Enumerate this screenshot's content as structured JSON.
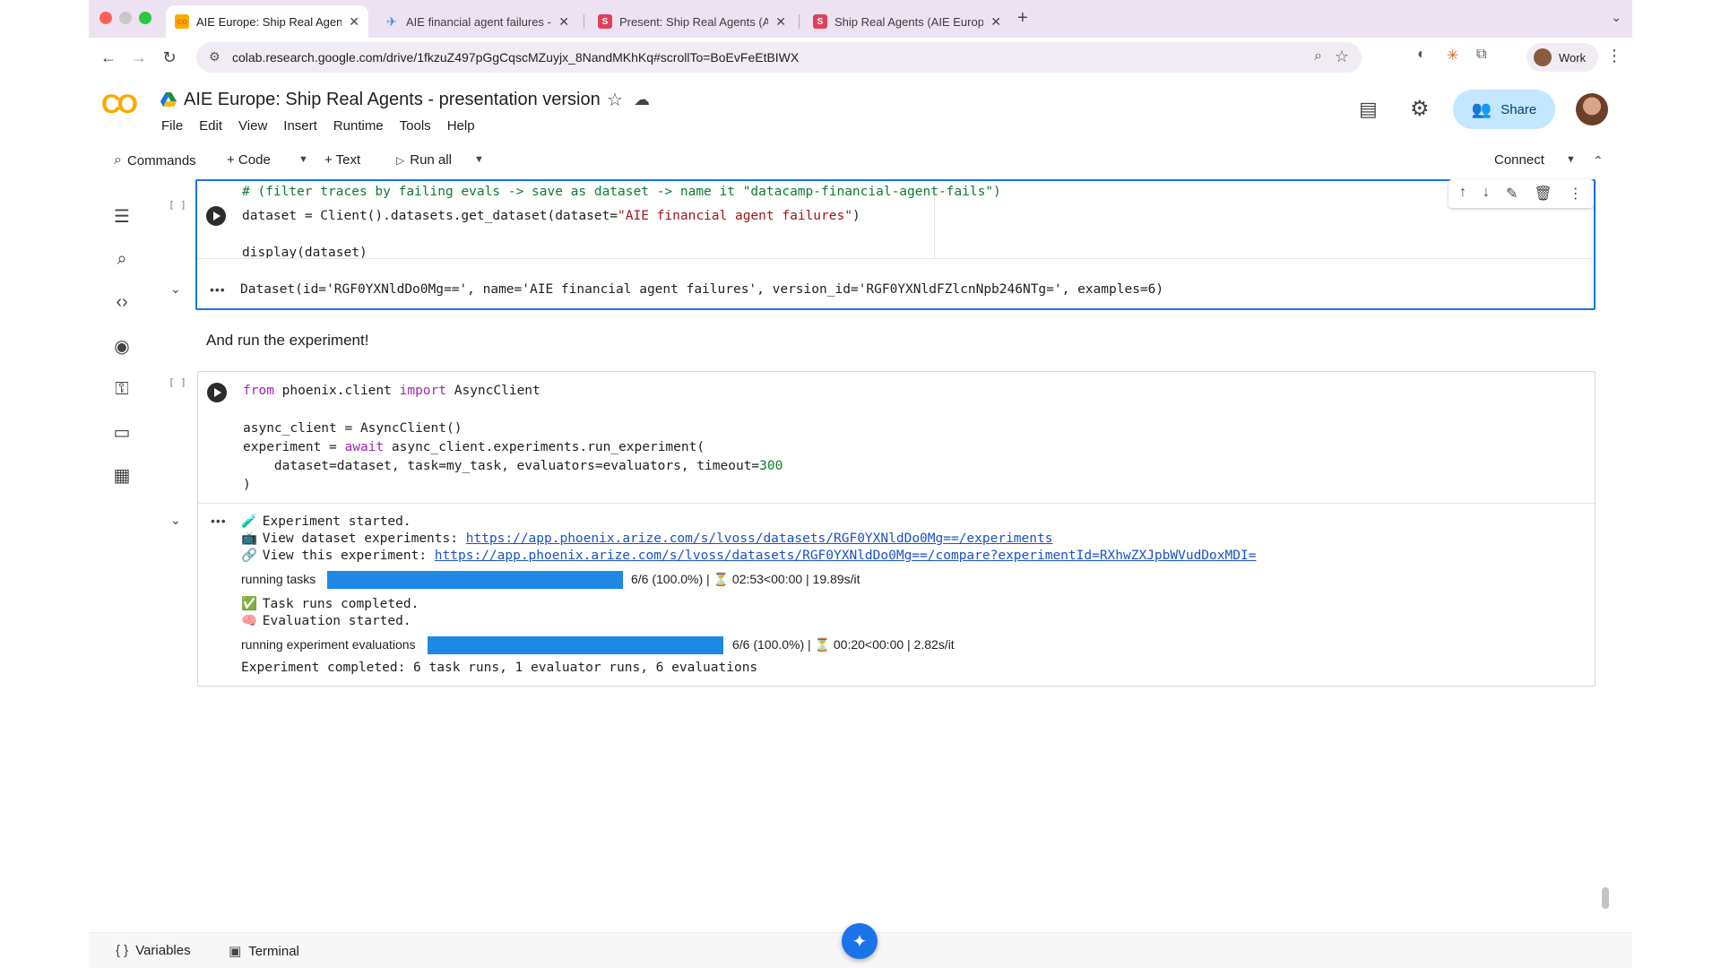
{
  "browser": {
    "tabs": [
      {
        "title": "AIE Europe: Ship Real Agents",
        "favicon": "colab-logo",
        "active": true
      },
      {
        "title": "AIE financial agent failures - D",
        "favicon": "phoenix-icon",
        "active": false
      },
      {
        "title": "Present: Ship Real Agents (AI",
        "favicon": "slides-icon",
        "active": false
      },
      {
        "title": "Ship Real Agents (AIE Europe",
        "favicon": "slides-icon",
        "active": false
      }
    ],
    "url": "colab.research.google.com/drive/1fkzuZ497pGgCqscMZuyjx_8NandMKhKq#scrollTo=BoEvFeEtBIWX",
    "profile_label": "Work"
  },
  "colab": {
    "logo_text": "CO",
    "notebook_title": "AIE Europe: Ship Real Agents - presentation version",
    "menu": [
      "File",
      "Edit",
      "View",
      "Insert",
      "Runtime",
      "Tools",
      "Help"
    ],
    "share_label": "Share",
    "toolbar": {
      "commands": "Commands",
      "code": "+ Code",
      "text": "+ Text",
      "run_all": "Run all",
      "connect": "Connect"
    }
  },
  "cells": {
    "cell1": {
      "bracket": "[ ]",
      "comment_line": "# (filter traces by failing evals -> save as dataset -> name it \"datacamp-financial-agent-fails\")",
      "code_a": "dataset = Client().datasets.get_dataset(dataset=",
      "code_str": "\"AIE financial agent failures\"",
      "code_b": ")",
      "code_display": "display(dataset)",
      "output": "Dataset(id='RGF0YXNldDo0Mg==', name='AIE financial agent failures', version_id='RGF0YXNldFZlcnNpb246NTg=', examples=6)"
    },
    "markdown": "And run the experiment!",
    "cell2": {
      "bracket": "[ ]",
      "line1_kw1": "from",
      "line1_mod": " phoenix.client ",
      "line1_kw2": "import",
      "line1_name": " AsyncClient",
      "line2": "async_client = AsyncClient()",
      "line3_a": "experiment = ",
      "line3_kw": "await",
      "line3_b": " async_client.experiments.run_experiment(",
      "line4_a": "    dataset=dataset, task=my_task, evaluators=evaluators, timeout=",
      "line4_num": "300",
      "line5": ")",
      "output": {
        "started": "Experiment started.",
        "view_dataset_label": "View dataset experiments: ",
        "view_dataset_url": "https://app.phoenix.arize.com/s/lvoss/datasets/RGF0YXNldDo0Mg==/experiments",
        "view_exp_label": "View this experiment: ",
        "view_exp_url": "https://app.phoenix.arize.com/s/lvoss/datasets/RGF0YXNldDo0Mg==/compare?experimentId=RXhwZXJpbWVudDoxMDI=",
        "progress1": {
          "label": "running tasks",
          "value": 1.0,
          "stats": "6/6 (100.0%) | ⏳ 02:53<00:00 | 19.89s/it"
        },
        "task_done": "Task runs completed.",
        "eval_started": "Evaluation started.",
        "progress2": {
          "label": "running experiment evaluations",
          "value": 1.0,
          "stats": "6/6 (100.0%) | ⏳ 00:20<00:00 |  2.82s/it"
        },
        "completed": "Experiment completed: 6 task runs, 1 evaluator runs, 6 evaluations"
      }
    }
  },
  "bottom": {
    "variables": "Variables",
    "terminal": "Terminal"
  },
  "colors": {
    "accent": "#1a73e8",
    "progress_fill": "#1e88e5",
    "keyword": "#9c27b0",
    "string": "#a31515",
    "number": "#0b7c2e",
    "tabstrip": "#ede2f2"
  }
}
